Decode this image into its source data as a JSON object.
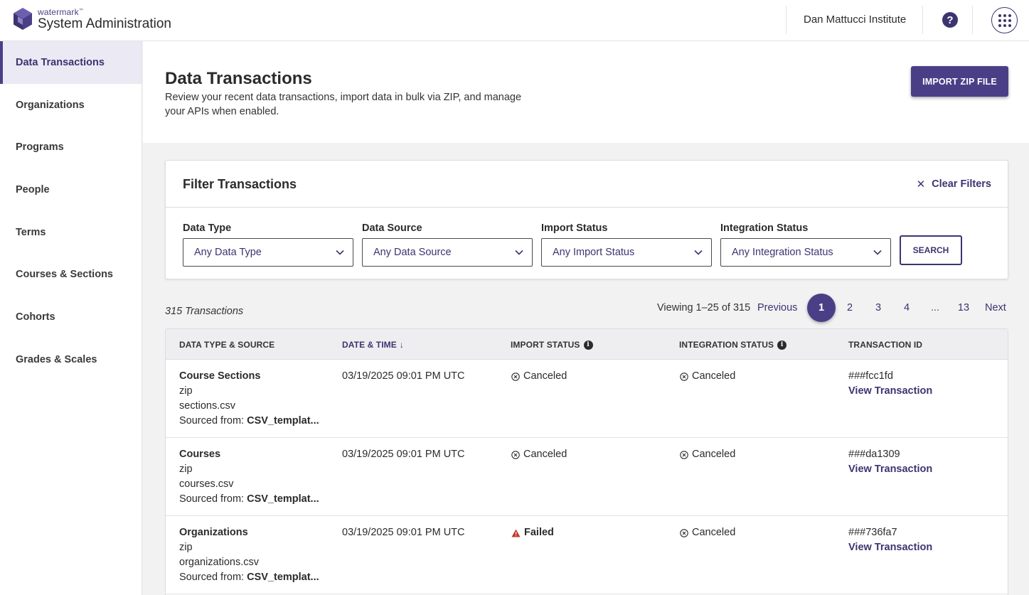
{
  "header": {
    "brand": "watermark",
    "brand_tm": "™",
    "app_title": "System Administration",
    "institution": "Dan Mattucci Institute",
    "help_icon": "question-circle-icon",
    "apps_icon": "grid-dots-icon"
  },
  "sidebar": {
    "items": [
      {
        "label": "Data Transactions",
        "active": true
      },
      {
        "label": "Organizations"
      },
      {
        "label": "Programs"
      },
      {
        "label": "People"
      },
      {
        "label": "Terms"
      },
      {
        "label": "Courses & Sections"
      },
      {
        "label": "Cohorts"
      },
      {
        "label": "Grades & Scales"
      }
    ]
  },
  "page": {
    "title": "Data Transactions",
    "description": "Review your recent data transactions, import data in bulk via ZIP, and manage your APIs when enabled.",
    "import_button": "IMPORT ZIP FILE"
  },
  "filters": {
    "title": "Filter Transactions",
    "clear_label": "Clear Filters",
    "fields": [
      {
        "label": "Data Type",
        "value": "Any Data Type"
      },
      {
        "label": "Data Source",
        "value": "Any Data Source"
      },
      {
        "label": "Import Status",
        "value": "Any Import Status"
      },
      {
        "label": "Integration Status",
        "value": "Any Integration Status"
      }
    ],
    "search_button": "SEARCH"
  },
  "results": {
    "count_label": "315 Transactions",
    "viewing_label": "Viewing 1–25 of 315",
    "previous": "Previous",
    "next": "Next",
    "pages": [
      "1",
      "2",
      "3",
      "4",
      "...",
      "13"
    ],
    "current_page": "1"
  },
  "table": {
    "columns": {
      "data_type": "DATA TYPE & SOURCE",
      "date_time": "DATE & TIME",
      "sort_arrow": "↓",
      "import_status": "IMPORT STATUS",
      "integration_status": "INTEGRATION STATUS",
      "transaction_id": "TRANSACTION ID"
    },
    "sourced_prefix": "Sourced from:",
    "view_link": "View Transaction",
    "rows": [
      {
        "type": "Course Sections",
        "format": "zip",
        "file": "sections.csv",
        "source": "CSV_templat...",
        "datetime": "03/19/2025 09:01 PM UTC",
        "import_status": "Canceled",
        "integration_status": "Canceled",
        "transaction_id": "###fcc1fd"
      },
      {
        "type": "Courses",
        "format": "zip",
        "file": "courses.csv",
        "source": "CSV_templat...",
        "datetime": "03/19/2025 09:01 PM UTC",
        "import_status": "Canceled",
        "integration_status": "Canceled",
        "transaction_id": "###da1309"
      },
      {
        "type": "Organizations",
        "format": "zip",
        "file": "organizations.csv",
        "source": "CSV_templat...",
        "datetime": "03/19/2025 09:01 PM UTC",
        "import_status": "Failed",
        "integration_status": "Canceled",
        "transaction_id": "###736fa7"
      }
    ]
  },
  "colors": {
    "brand_purple": "#4a3f87",
    "link_purple": "#3c3470",
    "failed_red": "#c0392b"
  }
}
